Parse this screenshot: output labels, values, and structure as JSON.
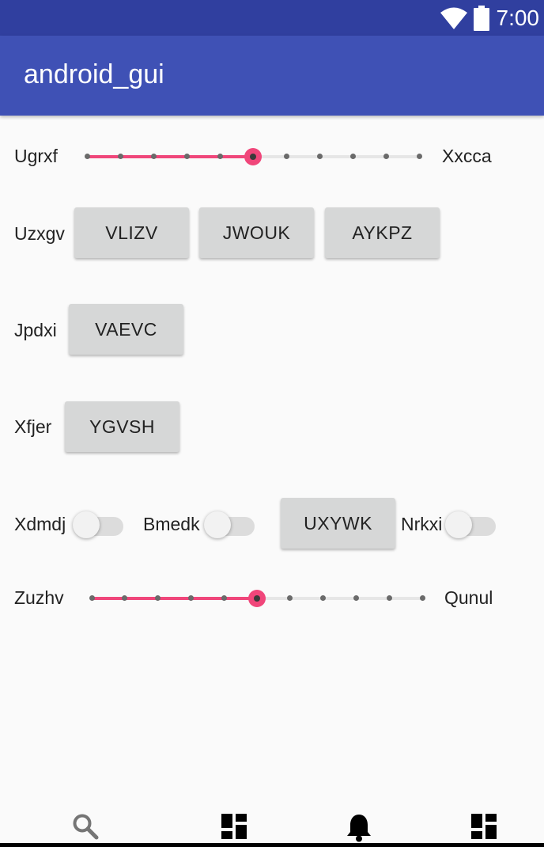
{
  "status_bar": {
    "time": "7:00",
    "icons": [
      "wifi-icon",
      "battery-icon"
    ]
  },
  "app_bar": {
    "title": "android_gui"
  },
  "colors": {
    "primary": "#3f51b5",
    "primary_dark": "#303f9f",
    "accent": "#f0467a",
    "button": "#d6d7d7"
  },
  "slider1": {
    "left_label": "Ugrxf",
    "right_label": "Xxcca",
    "steps": 10,
    "value": 5
  },
  "row2": {
    "label": "Uzxgv",
    "buttons": [
      "VLIZV",
      "JWOUK",
      "AYKPZ"
    ]
  },
  "row3": {
    "label": "Jpdxi",
    "button": "VAEVC"
  },
  "row4": {
    "label": "Xfjer",
    "button": "YGVSH"
  },
  "row5": {
    "switch1": {
      "label": "Xdmdj",
      "checked": false
    },
    "switch2": {
      "label": "Bmedk",
      "checked": false
    },
    "button": "UXYWK",
    "switch3": {
      "label": "Nrkxi",
      "checked": false
    }
  },
  "slider2": {
    "left_label": "Zuzhv",
    "right_label": "Qunul",
    "steps": 10,
    "value": 5
  },
  "bottom_nav": {
    "items": [
      "search-icon",
      "dashboard-icon",
      "bell-icon",
      "dashboard-icon"
    ]
  }
}
